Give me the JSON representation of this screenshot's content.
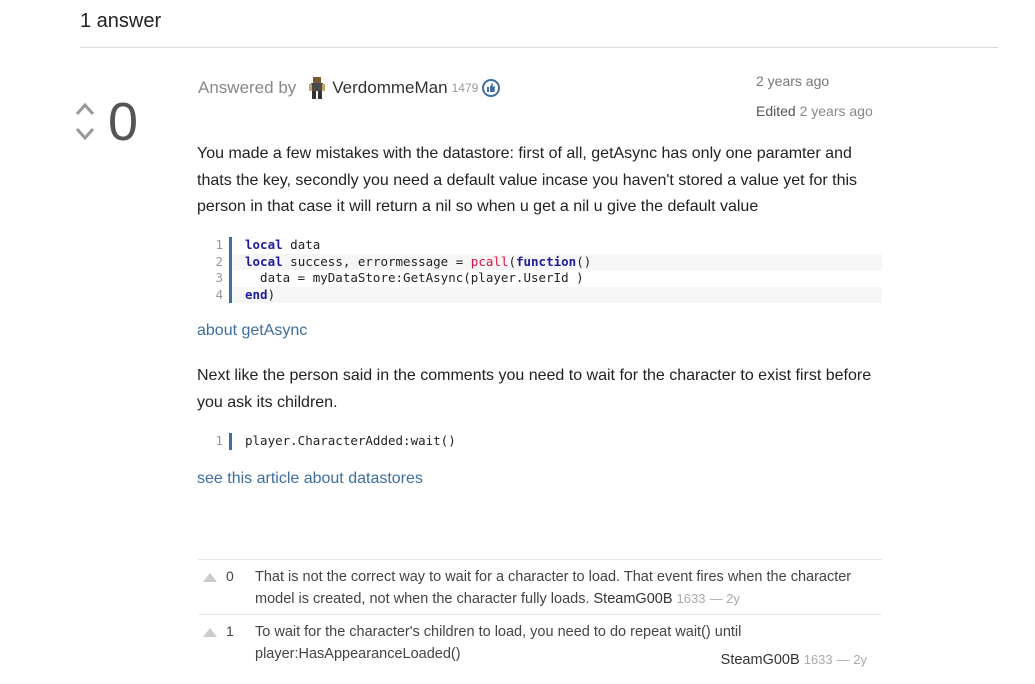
{
  "header": {
    "title": "1 answer"
  },
  "answer": {
    "score": "0",
    "answered_by_label": "Answered by",
    "author": "VerdommeMan",
    "author_rep": "1479",
    "posted": "2 years ago",
    "edited_label": "Edited",
    "edited": "2 years ago",
    "paragraph1": "You made a few mistakes with the datastore: first of all, getAsync has only one paramter and thats the key, secondly you need a default value incase you haven't stored a value yet for this person in that case it will return a nil so when u get a nil u give the default value",
    "code1": {
      "line_numbers": [
        "1",
        "2",
        "3",
        "4"
      ]
    },
    "link1": "about getAsync",
    "paragraph2": "Next like the person said in the comments you need to wait for the character to exist first before you ask its children.",
    "code2": {
      "line_numbers": [
        "1"
      ],
      "line1": "player.CharacterAdded:wait()"
    },
    "link2": "see this article about datastores"
  },
  "comments": [
    {
      "score": "0",
      "text": "That is not the correct way to wait for a character to load. That event fires when the character model is created, not when the character fully loads.",
      "author": "SteamG00B",
      "rep": "1633",
      "age": "— 2y"
    },
    {
      "score": "1",
      "text": "To wait for the character's children to load, you need to do repeat wait() until player:HasAppearanceLoaded()",
      "author": "SteamG00B",
      "rep": "1633",
      "age": "— 2y"
    }
  ],
  "colors": {
    "link": "#3d6e9f",
    "code_bar": "#3d6e9f",
    "badge": "#3d6e9f"
  }
}
